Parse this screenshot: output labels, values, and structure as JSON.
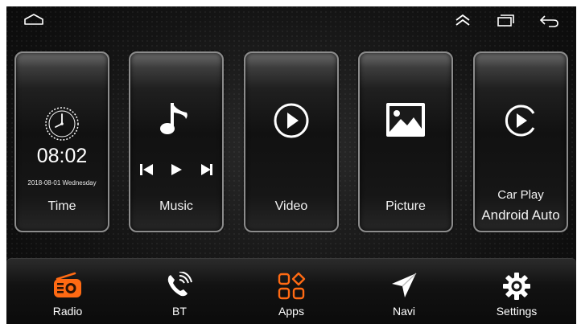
{
  "status_bar": {
    "icons": [
      "home-icon",
      "expand-up-icon",
      "recent-apps-icon",
      "back-icon"
    ]
  },
  "tiles": {
    "time": {
      "clock": "08:02",
      "date": "2018-08-01  Wednesday",
      "label": "Time"
    },
    "music": {
      "label": "Music",
      "icons": [
        "music-note-icon",
        "previous-icon",
        "play-icon",
        "next-icon"
      ]
    },
    "video": {
      "label": "Video",
      "icon": "play-circle-icon"
    },
    "picture": {
      "label": "Picture",
      "icon": "image-icon"
    },
    "carplay": {
      "label_line1": "Car Play",
      "label_line2": "Android Auto",
      "icon": "play-circle-icon"
    }
  },
  "dock": {
    "radio": {
      "label": "Radio",
      "icon": "radio-icon",
      "color": "#ff6a13"
    },
    "bt": {
      "label": "BT",
      "icon": "phone-bluetooth-icon"
    },
    "apps": {
      "label": "Apps",
      "icon": "apps-grid-icon",
      "color": "#ff6a13"
    },
    "navi": {
      "label": "Navi",
      "icon": "navigation-arrow-icon"
    },
    "settings": {
      "label": "Settings",
      "icon": "gear-icon"
    }
  },
  "colors": {
    "accent": "#ff6a13",
    "background": "#111111",
    "text": "#ffffff"
  }
}
